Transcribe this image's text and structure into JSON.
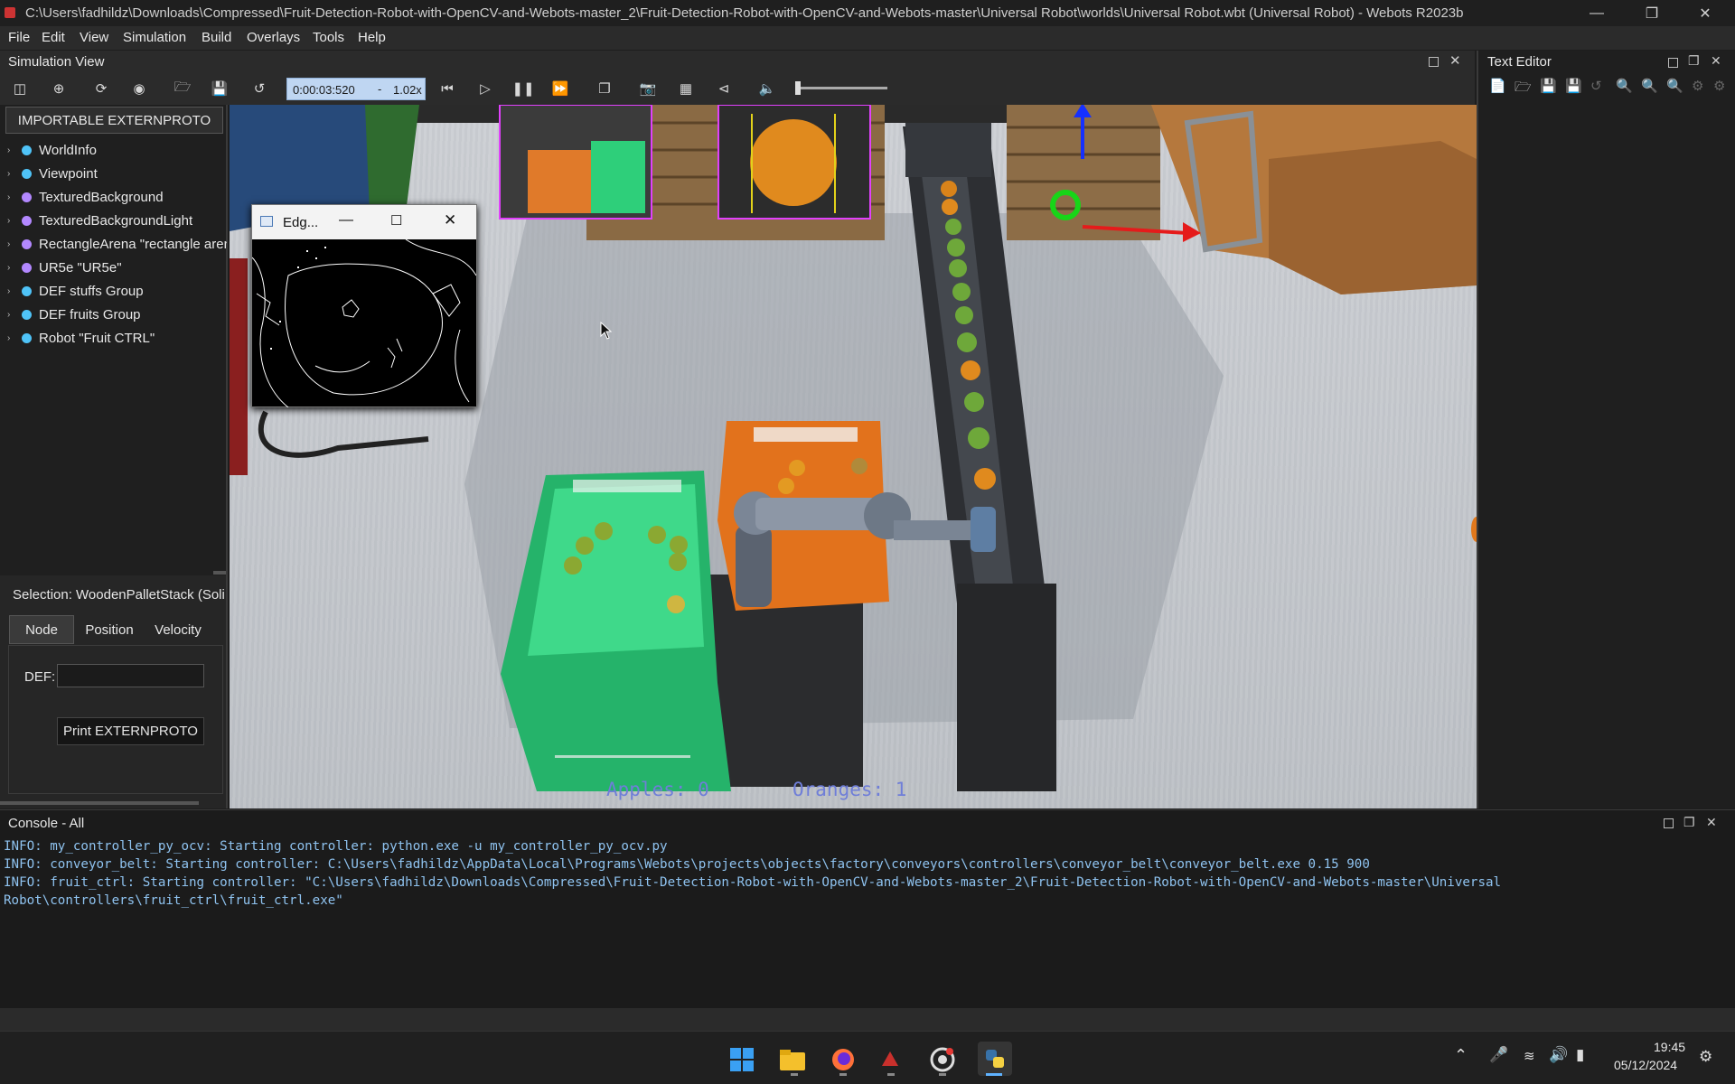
{
  "window": {
    "title": "C:\\Users\\fadhildz\\Downloads\\Compressed\\Fruit-Detection-Robot-with-OpenCV-and-Webots-master_2\\Fruit-Detection-Robot-with-OpenCV-and-Webots-master\\Universal Robot\\worlds\\Universal Robot.wbt (Universal Robot) - Webots R2023b"
  },
  "menu": [
    "File",
    "Edit",
    "View",
    "Simulation",
    "Build",
    "Overlays",
    "Tools",
    "Help"
  ],
  "simulation_view": {
    "title": "Simulation View",
    "time": "0:00:03:520",
    "separator": "-",
    "speed": "1.02x"
  },
  "scene_tree": {
    "extern_button": "IMPORTABLE EXTERNPROTO",
    "nodes": [
      {
        "label": "WorldInfo",
        "color": "#4fc3f7"
      },
      {
        "label": "Viewpoint",
        "color": "#4fc3f7"
      },
      {
        "label": "TexturedBackground",
        "color": "#b388ff"
      },
      {
        "label": "TexturedBackgroundLight",
        "color": "#b388ff"
      },
      {
        "label": "RectangleArena \"rectangle aren",
        "color": "#b388ff"
      },
      {
        "label": "UR5e \"UR5e\"",
        "color": "#b388ff"
      },
      {
        "label": "DEF stuffs Group",
        "color": "#4fc3f7"
      },
      {
        "label": "DEF fruits Group",
        "color": "#4fc3f7"
      },
      {
        "label": "Robot \"Fruit CTRL\"",
        "color": "#4fc3f7"
      }
    ]
  },
  "selection": {
    "title": "Selection: WoodenPalletStack (Soli",
    "tabs": [
      "Node",
      "Position",
      "Velocity"
    ],
    "def_label": "DEF:",
    "def_value": "",
    "print_button": "Print EXTERNPROTO"
  },
  "edge_window": {
    "title": "Edg..."
  },
  "overlay": {
    "apples": "Apples: 0",
    "oranges": "Oranges: 1"
  },
  "text_editor": {
    "title": "Text Editor"
  },
  "console": {
    "title": "Console - All",
    "lines": [
      "INFO: my_controller_py_ocv: Starting controller: python.exe -u my_controller_py_ocv.py",
      "INFO: conveyor_belt: Starting controller: C:\\Users\\fadhildz\\AppData\\Local\\Programs\\Webots\\projects\\objects\\factory\\conveyors\\controllers\\conveyor_belt\\conveyor_belt.exe 0.15 900",
      "INFO: fruit_ctrl: Starting controller: \"C:\\Users\\fadhildz\\Downloads\\Compressed\\Fruit-Detection-Robot-with-OpenCV-and-Webots-master_2\\Fruit-Detection-Robot-with-OpenCV-and-Webots-master\\Universal",
      "Robot\\controllers\\fruit_ctrl\\fruit_ctrl.exe\""
    ]
  },
  "taskbar": {
    "time": "19:45",
    "date": "05/12/2024"
  }
}
